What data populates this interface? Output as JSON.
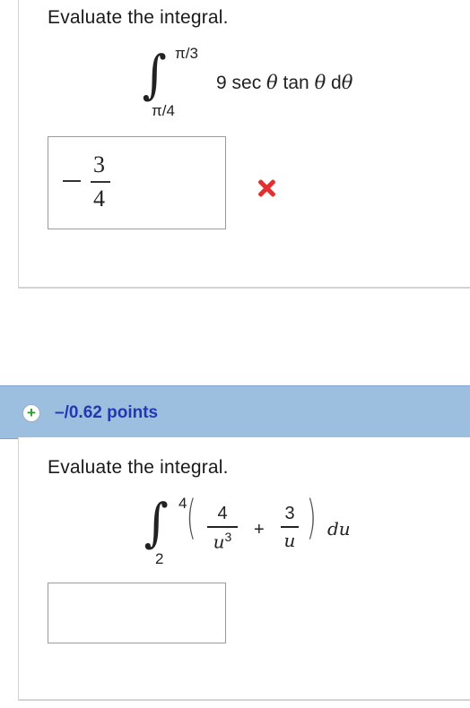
{
  "question1": {
    "prompt": "Evaluate the integral.",
    "integral": {
      "upper_limit": "π/3",
      "lower_limit": "π/4",
      "expression_coef": "9 sec ",
      "theta1": "θ",
      "mid": " tan ",
      "theta2": "θ",
      "d": " d",
      "theta3": "θ"
    },
    "answer": {
      "sign": "−",
      "numerator": "3",
      "denominator": "4",
      "status": "incorrect"
    },
    "colors": {
      "incorrect": "#e23030"
    }
  },
  "question2": {
    "points_label": "–/0.62 points",
    "expand_icon": "plus-circle-icon",
    "prompt": "Evaluate the integral.",
    "integral": {
      "upper_limit": "4",
      "lower_limit": "2",
      "term1_numerator": "4",
      "term1_denominator": "u",
      "term1_exponent": "3",
      "operator": "+",
      "term2_numerator": "3",
      "term2_denominator": "u",
      "differential": "du"
    },
    "answer": {
      "value": ""
    },
    "colors": {
      "header_bg": "#9cbfe0",
      "points_text": "#2337b2",
      "plus_icon": "#2f9b2f"
    }
  }
}
